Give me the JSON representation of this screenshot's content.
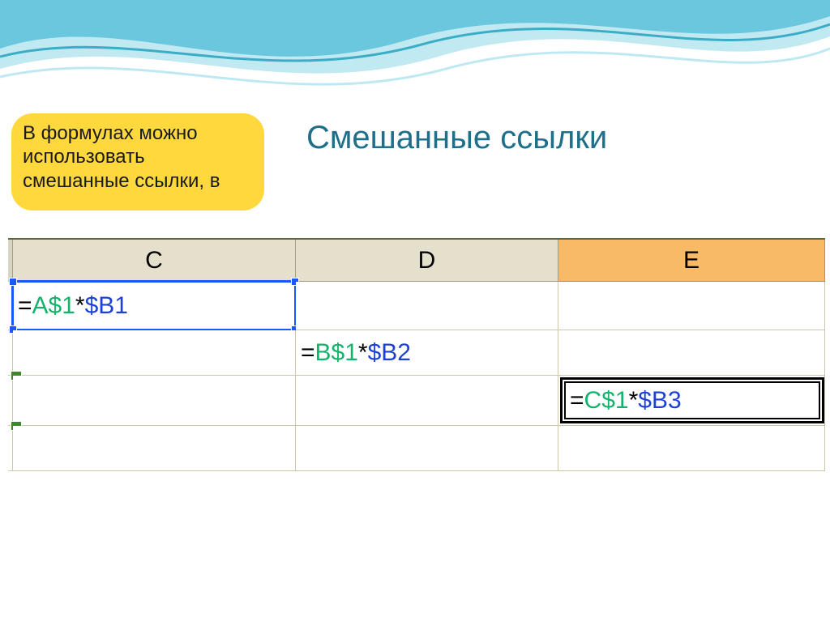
{
  "title": "Смешанные ссылки",
  "callout": {
    "line1": "   В формулах можно",
    "line2": "использовать",
    "line3": "смешанные ссылки, в"
  },
  "columns": {
    "C": "C",
    "D": "D",
    "E": "E"
  },
  "cells": {
    "C1": {
      "eq": "=",
      "ref1": "A$1",
      "op": "*",
      "ref2": "$B1"
    },
    "D2": {
      "eq": "=",
      "ref1": "B$1",
      "op": "*",
      "ref2": "$B2"
    },
    "E3": {
      "eq": "=",
      "ref1": "C$1",
      "op": "*",
      "ref2": "$B3"
    }
  }
}
